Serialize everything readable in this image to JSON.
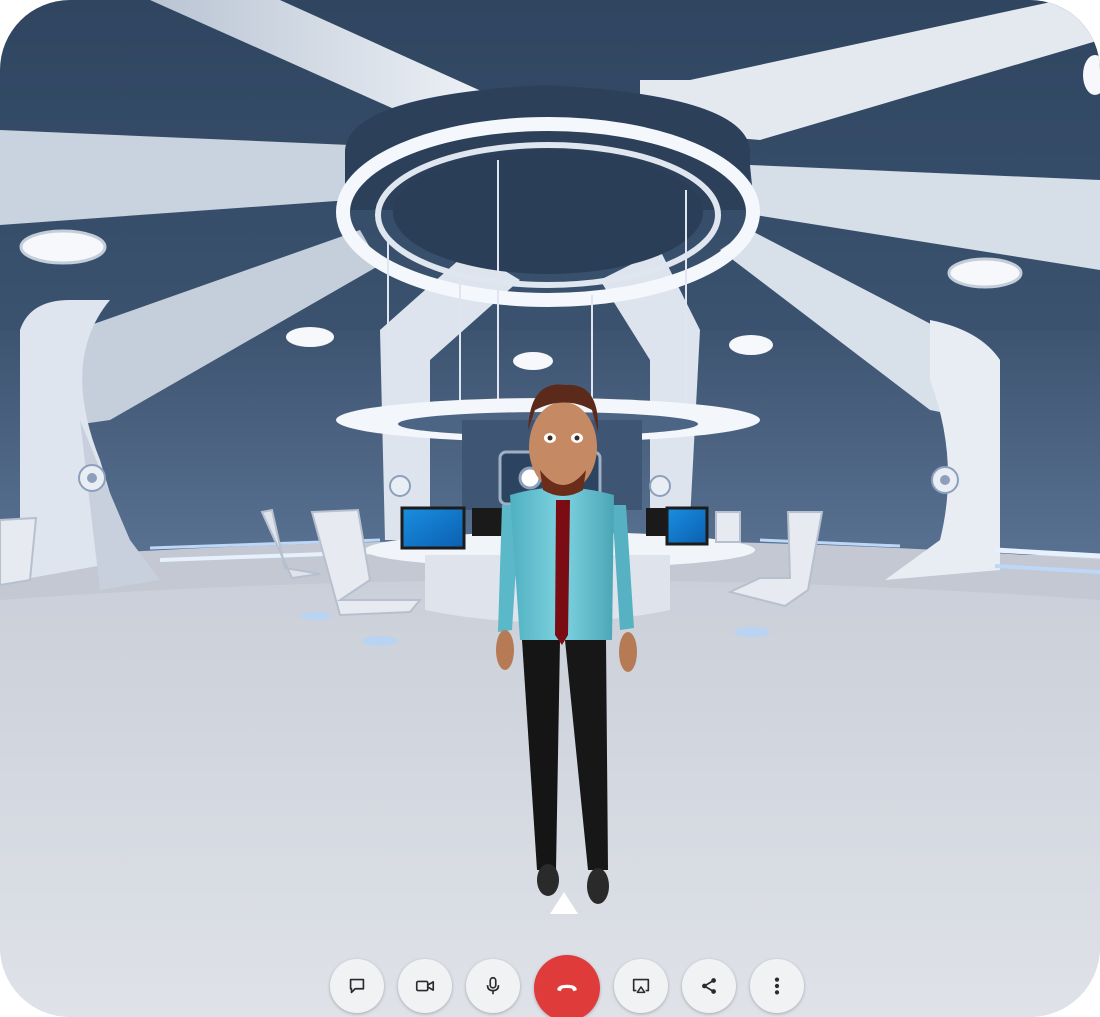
{
  "scene": {
    "name": "virtual-meeting-room",
    "avatar": "male-avatar"
  },
  "toolbar": {
    "buttons": [
      {
        "id": "chat",
        "icon": "chat-bubble-icon"
      },
      {
        "id": "camera",
        "icon": "video-camera-icon"
      },
      {
        "id": "microphone",
        "icon": "microphone-icon"
      },
      {
        "id": "end-call",
        "icon": "hang-up-icon"
      },
      {
        "id": "screen-share",
        "icon": "cast-screen-icon"
      },
      {
        "id": "share",
        "icon": "share-icon"
      },
      {
        "id": "more",
        "icon": "more-vertical-icon"
      }
    ]
  },
  "colors": {
    "ceiling": "#3f5673",
    "wall": "#4f6683",
    "floor": "#d9dce3",
    "beam": "#dfe5ee",
    "end_call": "#e03b3b",
    "button_bg": "#f1f2f4",
    "icon": "#2b2b2b"
  }
}
